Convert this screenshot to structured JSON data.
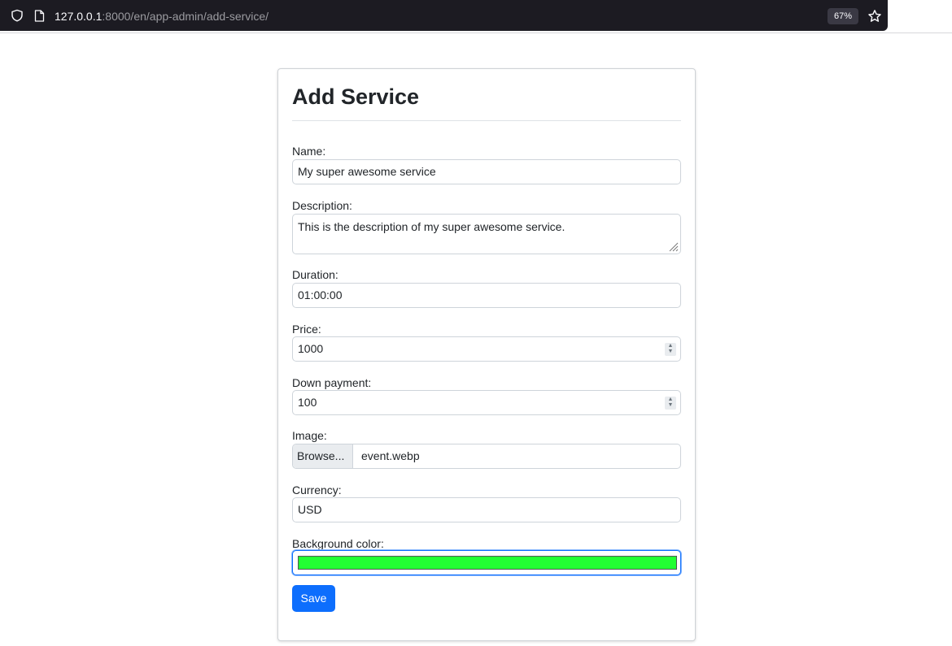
{
  "browser": {
    "url_host": "127.0.0.1",
    "url_rest": ":8000/en/app-admin/add-service/",
    "zoom": "67%"
  },
  "form": {
    "title": "Add Service",
    "name": {
      "label": "Name:",
      "value": "My super awesome service"
    },
    "description": {
      "label": "Description:",
      "value": "This is the description of my super awesome service."
    },
    "duration": {
      "label": "Duration:",
      "value": "01:00:00"
    },
    "price": {
      "label": "Price:",
      "value": "1000"
    },
    "down_payment": {
      "label": "Down payment:",
      "value": "100"
    },
    "image": {
      "label": "Image:",
      "browse_label": "Browse...",
      "file_name": "event.webp"
    },
    "currency": {
      "label": "Currency:",
      "value": "USD"
    },
    "background_color": {
      "label": "Background color:",
      "value": "#22ff33"
    },
    "save_label": "Save"
  },
  "colors": {
    "accent": "#0d6efd",
    "chrome_dark": "#1c1b22"
  },
  "icons": {
    "tracking": "shield-icon",
    "page": "page-icon",
    "bookmark": "star-icon"
  }
}
